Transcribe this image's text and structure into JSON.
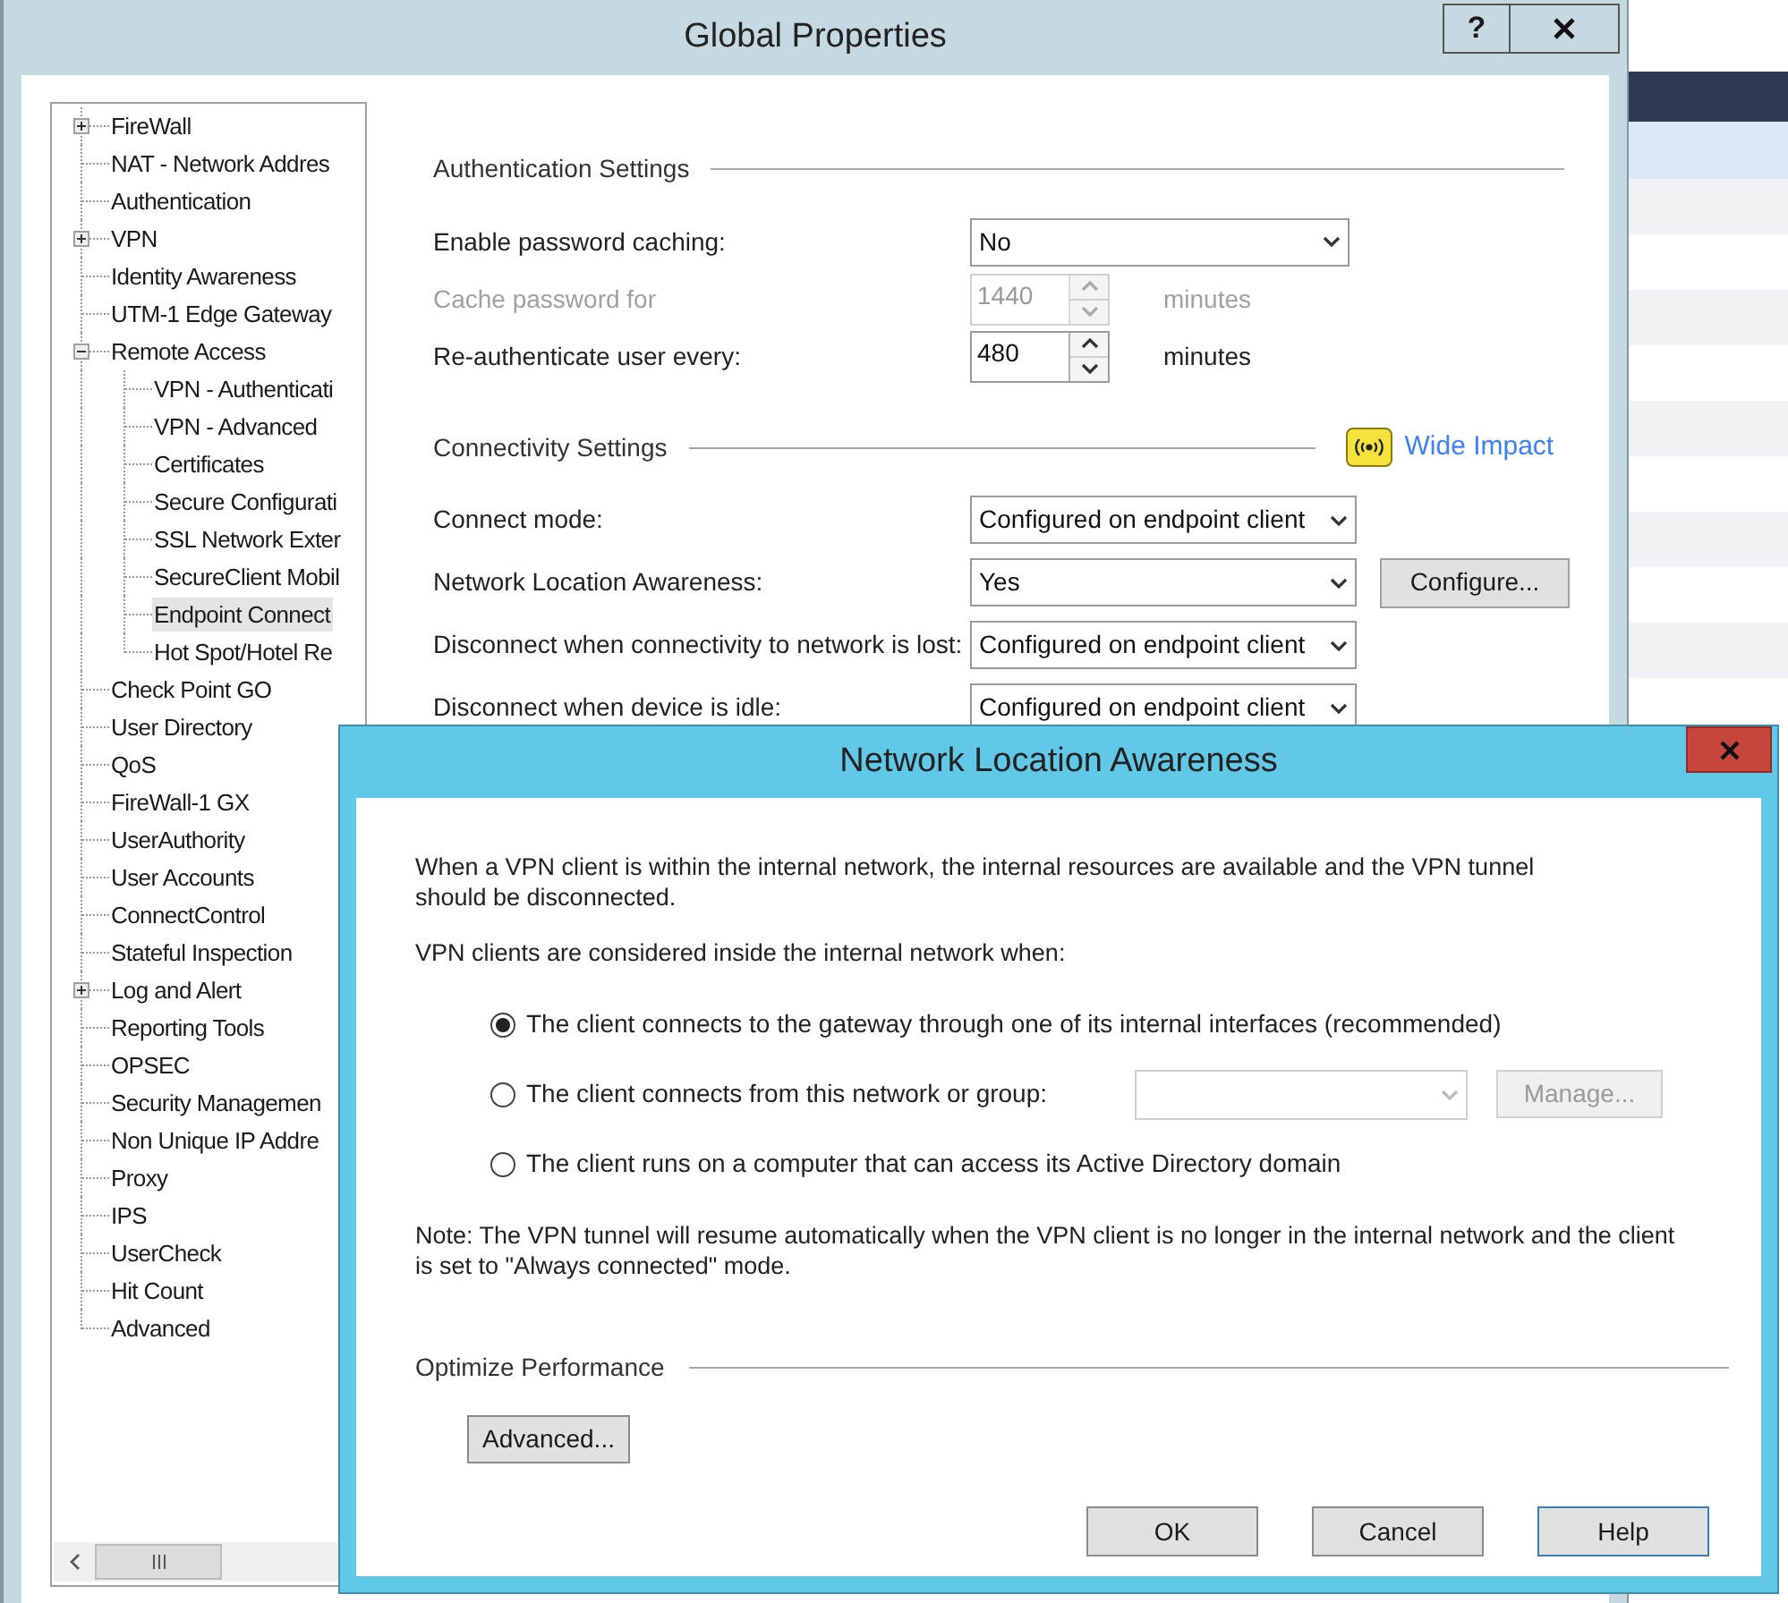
{
  "window": {
    "title": "Global Properties",
    "help": "?"
  },
  "tree": [
    {
      "label": "FireWall",
      "selected": false,
      "expanded": false
    },
    {
      "label": "NAT - Network Addres",
      "selected": false
    },
    {
      "label": "Authentication",
      "selected": false
    },
    {
      "label": "VPN",
      "selected": false,
      "expanded": false
    },
    {
      "label": "Identity Awareness",
      "selected": false
    },
    {
      "label": "UTM-1 Edge Gateway",
      "selected": false
    },
    {
      "label": "Remote Access",
      "selected": false,
      "expanded": true,
      "children": [
        {
          "label": "VPN - Authenticati",
          "selected": false
        },
        {
          "label": "VPN - Advanced",
          "selected": false
        },
        {
          "label": "Certificates",
          "selected": false
        },
        {
          "label": "Secure Configurati",
          "selected": false
        },
        {
          "label": "SSL Network Exter",
          "selected": false
        },
        {
          "label": "SecureClient Mobil",
          "selected": false
        },
        {
          "label": "Endpoint Connect",
          "selected": true
        },
        {
          "label": "Hot Spot/Hotel Re",
          "selected": false
        }
      ]
    },
    {
      "label": "Check Point GO",
      "selected": false
    },
    {
      "label": "User Directory",
      "selected": false
    },
    {
      "label": "QoS",
      "selected": false
    },
    {
      "label": "FireWall-1 GX",
      "selected": false
    },
    {
      "label": "UserAuthority",
      "selected": false
    },
    {
      "label": "User Accounts",
      "selected": false
    },
    {
      "label": "ConnectControl",
      "selected": false
    },
    {
      "label": "Stateful Inspection",
      "selected": false
    },
    {
      "label": "Log and Alert",
      "selected": false,
      "expanded": false
    },
    {
      "label": "Reporting Tools",
      "selected": false
    },
    {
      "label": "OPSEC",
      "selected": false
    },
    {
      "label": "Security Managemen",
      "selected": false
    },
    {
      "label": "Non Unique IP Addre",
      "selected": false
    },
    {
      "label": "Proxy",
      "selected": false
    },
    {
      "label": "IPS",
      "selected": false
    },
    {
      "label": "UserCheck",
      "selected": false
    },
    {
      "label": "Hit Count",
      "selected": false
    },
    {
      "label": "Advanced",
      "selected": false
    }
  ],
  "authentication_settings": {
    "heading": "Authentication Settings",
    "fields": [
      {
        "kind": "select",
        "label": "Enable password caching:",
        "value": "No",
        "disabled": false
      },
      {
        "kind": "spinner",
        "label": "Cache password for",
        "value": "1440",
        "unit": "minutes",
        "disabled": true
      },
      {
        "kind": "spinner",
        "label": "Re-authenticate user every:",
        "value": "480",
        "unit": "minutes",
        "disabled": false
      }
    ]
  },
  "connectivity_settings": {
    "heading": "Connectivity Settings",
    "impact": "Wide Impact",
    "fields": [
      {
        "kind": "select",
        "label": "Connect mode:",
        "value": "Configured on endpoint client",
        "disabled": false
      },
      {
        "kind": "select",
        "label": "Network Location Awareness:",
        "value": "Yes",
        "disabled": false,
        "button": "Configure..."
      },
      {
        "kind": "select",
        "label": "Disconnect when connectivity to network is lost:",
        "value": "Configured on endpoint client",
        "disabled": false
      },
      {
        "kind": "select",
        "label": "Disconnect when device is idle:",
        "value": "Configured on endpoint client",
        "disabled": false
      }
    ]
  },
  "dialog": {
    "title": "Network Location Awareness",
    "intro": "When a VPN client is within the internal network, the internal resources are available and the VPN tunnel should be disconnected.",
    "prompt": "VPN clients are considered inside the internal network when:",
    "options": [
      {
        "label": "The client connects to the gateway through one of its internal interfaces (recommended)",
        "selected": true
      },
      {
        "label": "The client connects from this network or group:",
        "selected": false,
        "kind": "network",
        "select_disabled": true,
        "manage_button": "Manage...",
        "manage_disabled": true
      },
      {
        "label": "The client runs on a computer that can access its Active Directory domain",
        "selected": false
      }
    ],
    "note": "Note: The VPN tunnel will resume automatically when the VPN client is no longer in the internal network and the client is set to \"Always connected\" mode.",
    "section": "Optimize Performance",
    "advanced_button": "Advanced...",
    "buttons": [
      {
        "label": "OK",
        "default": false
      },
      {
        "label": "Cancel",
        "default": false
      },
      {
        "label": "Help",
        "default": true
      }
    ]
  }
}
